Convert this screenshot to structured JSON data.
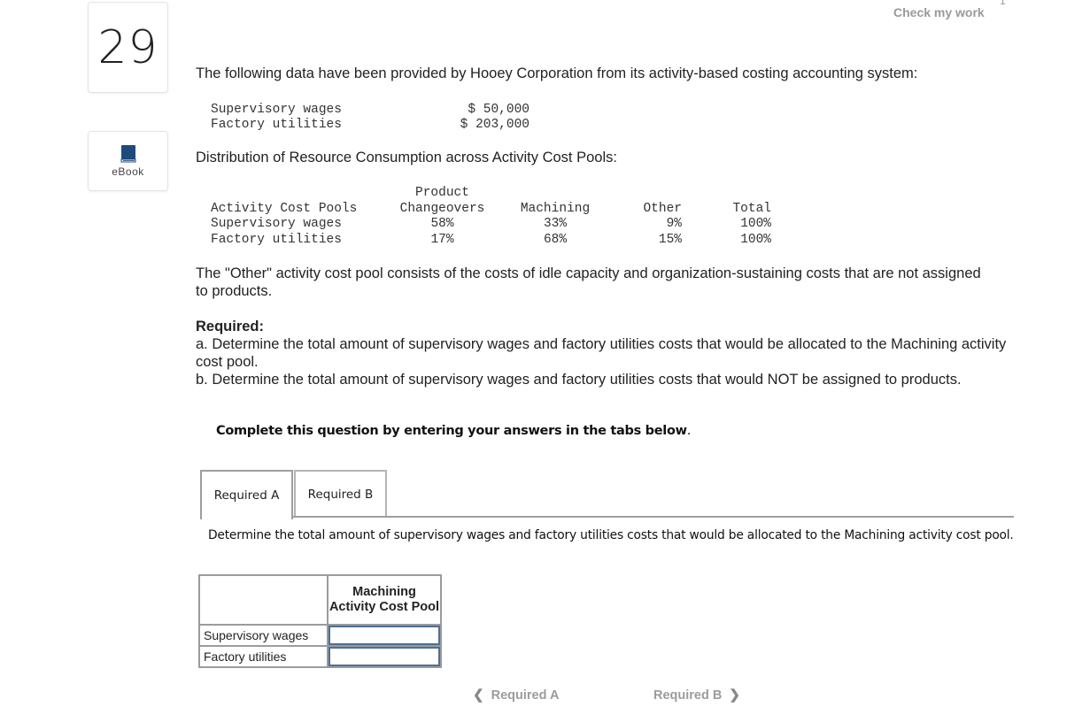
{
  "question": {
    "number": "29",
    "ebook_label": "eBook",
    "check_my_work": "Check my work",
    "check_count": "1"
  },
  "intro": "The following data have been provided by Hooey Corporation from its activity-based costing accounting system:",
  "costs": [
    {
      "label": "Supervisory wages",
      "value": "$ 50,000"
    },
    {
      "label": "Factory utilities",
      "value": "$ 203,000"
    }
  ],
  "distribution_heading": "Distribution of Resource Consumption across Activity Cost Pools:",
  "distribution": {
    "header_top": "Product",
    "headers": [
      "Activity Cost Pools",
      "Changeovers",
      "Machining",
      "Other",
      "Total"
    ],
    "rows": [
      [
        "Supervisory wages",
        "58%",
        "33%",
        "9%",
        "100%"
      ],
      [
        "Factory utilities",
        "17%",
        "68%",
        "15%",
        "100%"
      ]
    ]
  },
  "other_note": "The \"Other\" activity cost pool consists of the costs of idle capacity and organization-sustaining costs that are not assigned to products.",
  "required": {
    "heading": "Required:",
    "a": "a. Determine the total amount of supervisory wages and factory utilities costs that would be allocated to the Machining activity cost pool.",
    "b": "b. Determine the total amount of supervisory wages and factory utilities costs that would NOT be assigned to products."
  },
  "instruction": "Complete this question by entering your answers in the tabs below",
  "instruction_end": ".",
  "tabs": [
    {
      "label": "Required A",
      "active": true
    },
    {
      "label": "Required B",
      "active": false
    }
  ],
  "tab_a": {
    "description": "Determine the total amount of supervisory wages and factory utilities costs that would be allocated to the Machining activity cost pool.",
    "column_header": "Machining Activity Cost Pool",
    "rows": [
      {
        "label": "Supervisory wages",
        "value": ""
      },
      {
        "label": "Factory utilities",
        "value": ""
      }
    ]
  },
  "nav": {
    "prev": "Required A",
    "next": "Required B"
  },
  "colors": {
    "ebook_icon": "#1f4a7c",
    "input_border": "#4d6f96",
    "muted_text": "#9c9c9c"
  }
}
